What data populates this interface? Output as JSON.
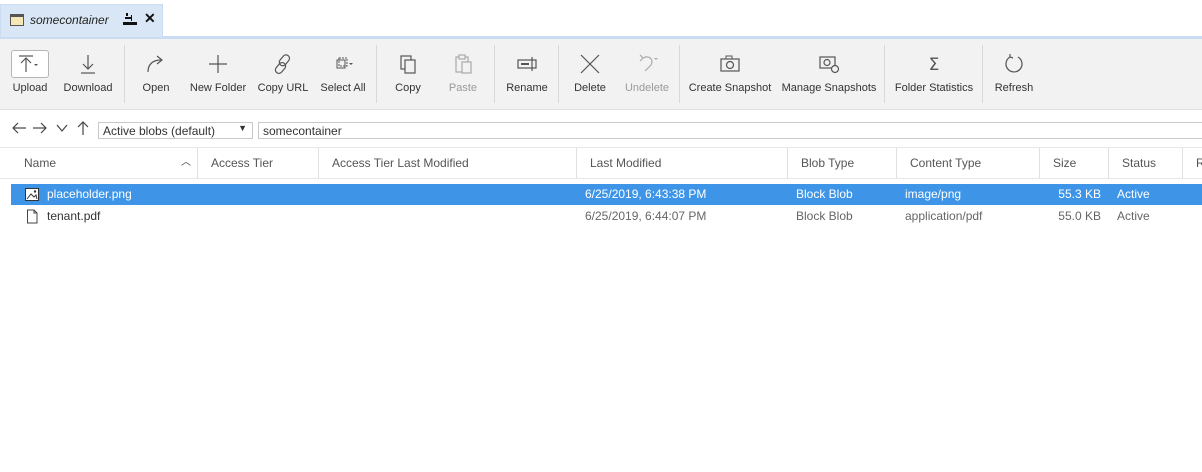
{
  "tab": {
    "title": "somecontainer"
  },
  "toolbar": {
    "upload": "Upload",
    "download": "Download",
    "open": "Open",
    "new_folder": "New Folder",
    "copy_url": "Copy URL",
    "select_all": "Select All",
    "copy": "Copy",
    "paste": "Paste",
    "rename": "Rename",
    "delete": "Delete",
    "undelete": "Undelete",
    "create_snapshot": "Create Snapshot",
    "manage_snapshots": "Manage Snapshots",
    "folder_statistics": "Folder Statistics",
    "refresh": "Refresh"
  },
  "address": {
    "view_select": "Active blobs (default)",
    "path": "somecontainer"
  },
  "columns": {
    "name": "Name",
    "access_tier": "Access Tier",
    "access_tier_last_modified": "Access Tier Last Modified",
    "last_modified": "Last Modified",
    "blob_type": "Blob Type",
    "content_type": "Content Type",
    "size": "Size",
    "status": "Status",
    "remaining": "R"
  },
  "rows": [
    {
      "name": "placeholder.png",
      "last_modified": "6/25/2019, 6:43:38 PM",
      "blob_type": "Block Blob",
      "content_type": "image/png",
      "size": "55.3 KB",
      "status": "Active",
      "icon": "image-file-icon"
    },
    {
      "name": "tenant.pdf",
      "last_modified": "6/25/2019, 6:44:07 PM",
      "blob_type": "Block Blob",
      "content_type": "application/pdf",
      "size": "55.0 KB",
      "status": "Active",
      "icon": "document-file-icon"
    }
  ],
  "colors": {
    "selection": "#3e95e7",
    "tab_background": "#d9e6f5",
    "toolbar_background": "#f2f2f2"
  }
}
